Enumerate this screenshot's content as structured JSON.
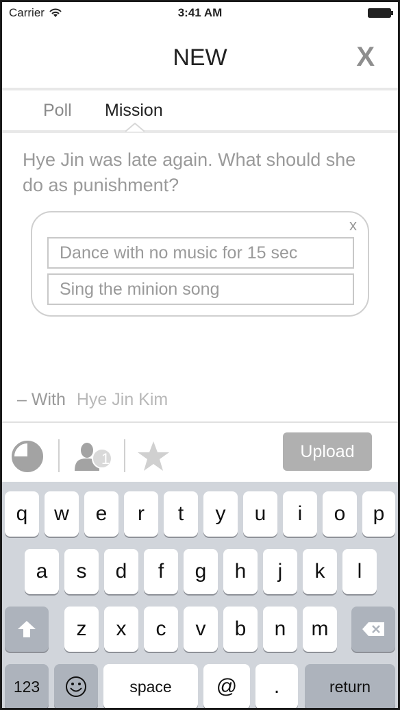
{
  "status_bar": {
    "carrier": "Carrier",
    "time": "3:41 AM"
  },
  "header": {
    "title": "NEW",
    "close_label": "X"
  },
  "tabs": [
    {
      "label": "Poll"
    },
    {
      "label": "Mission"
    }
  ],
  "question": "Hye Jin was late again. What should she do as punishment?",
  "options": {
    "close_label": "x",
    "items": [
      {
        "value": "Dance with no music for 15 sec"
      },
      {
        "value": "Sing the minion song"
      }
    ]
  },
  "with": {
    "label": "– With",
    "name": "Hye Jin Kim"
  },
  "toolbar": {
    "participant_count": "1",
    "upload_label": "Upload"
  },
  "keyboard": {
    "row1": [
      "q",
      "w",
      "e",
      "r",
      "t",
      "y",
      "u",
      "i",
      "o",
      "p"
    ],
    "row2": [
      "a",
      "s",
      "d",
      "f",
      "g",
      "h",
      "j",
      "k",
      "l"
    ],
    "row3": [
      "z",
      "x",
      "c",
      "v",
      "b",
      "n",
      "m"
    ],
    "numbers_label": "123",
    "space_label": "space",
    "at_label": "@",
    "dot_label": ".",
    "return_label": "return"
  },
  "colors": {
    "accent_gray": "#b0b0b0",
    "keyboard_bg": "#d1d5db"
  }
}
